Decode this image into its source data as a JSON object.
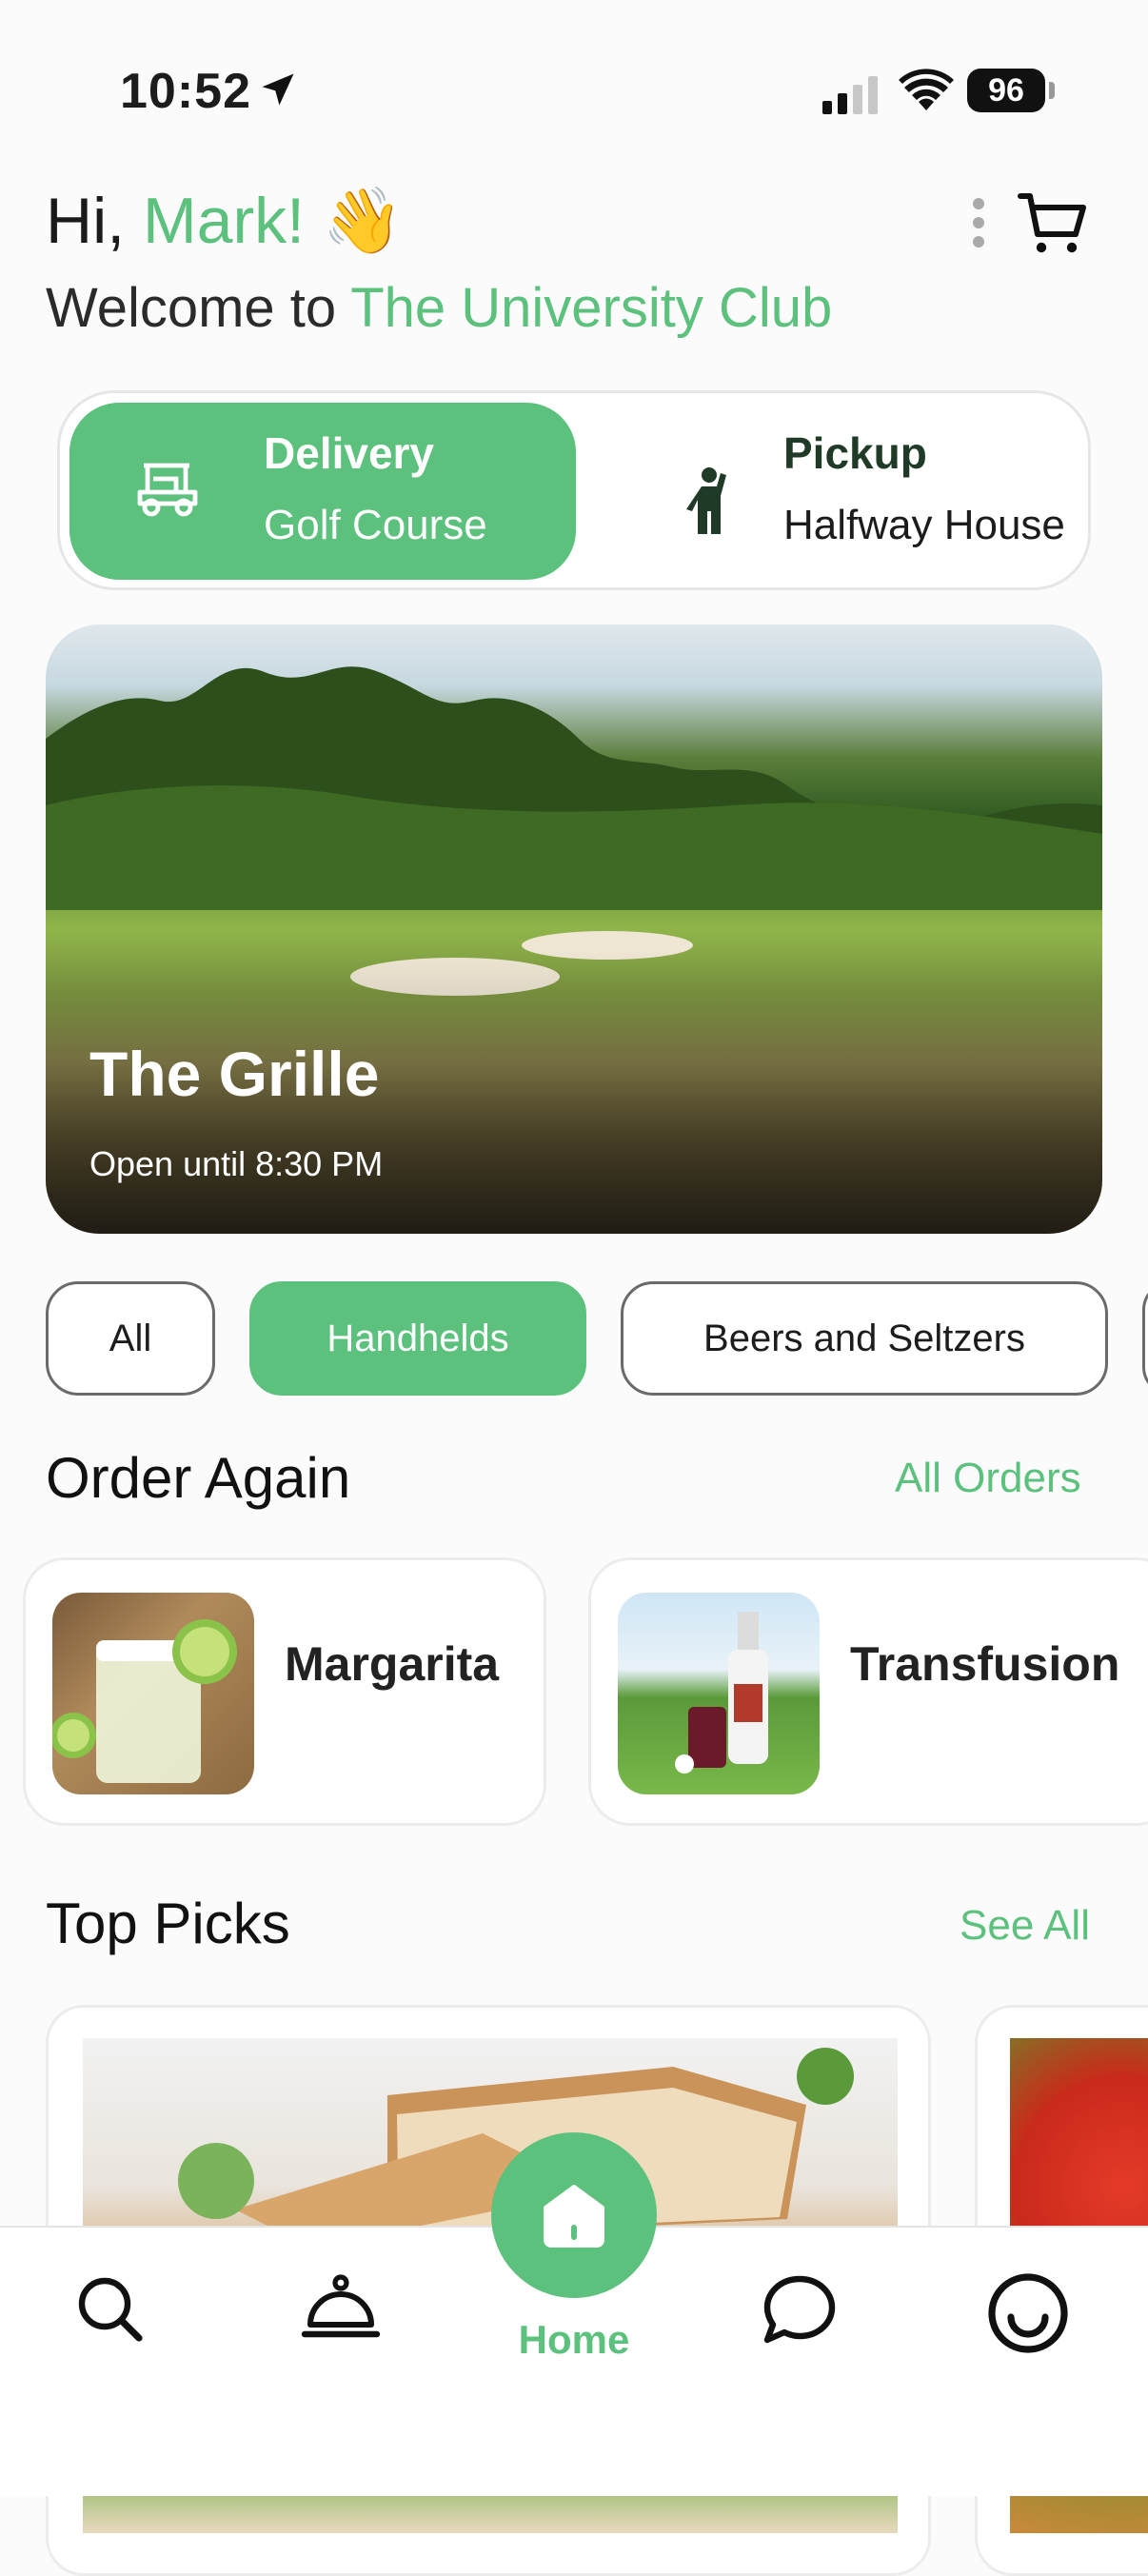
{
  "status_bar": {
    "time": "10:52",
    "battery": "96"
  },
  "header": {
    "greeting_prefix": "Hi, ",
    "user_name": "Mark!",
    "wave_emoji": "👋",
    "welcome_prefix": "Welcome to ",
    "club_name": "The University Club"
  },
  "mode_toggle": {
    "delivery": {
      "title": "Delivery",
      "subtitle": "Golf Course"
    },
    "pickup": {
      "title": "Pickup",
      "subtitle": "Halfway House"
    }
  },
  "hero": {
    "title": "The Grille",
    "subtitle": "Open until 8:30 PM"
  },
  "categories": [
    "All",
    "Handhelds",
    "Beers and Seltzers"
  ],
  "order_again": {
    "title": "Order Again",
    "link": "All Orders",
    "items": [
      {
        "name": "Margarita"
      },
      {
        "name": "Transfusion"
      }
    ]
  },
  "top_picks": {
    "title": "Top Picks",
    "link": "See All"
  },
  "tab_bar": {
    "home_label": "Home",
    "icons": [
      "search-icon",
      "service-bell-icon",
      "home-icon",
      "chat-icon",
      "profile-icon"
    ]
  },
  "colors": {
    "accent": "#5bc17d",
    "dark_green": "#1f3a26"
  }
}
